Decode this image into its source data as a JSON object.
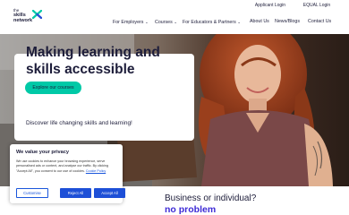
{
  "brand": {
    "line1": "the",
    "line2": "skills",
    "line3": "network",
    "accent": "#00c9a7",
    "accent_blue": "#2c4bd6"
  },
  "topbar": {
    "applicant_login": "Applicant Login",
    "equal_login": "EQUAL Login"
  },
  "nav": {
    "items": [
      {
        "label": "For Employers",
        "has_dropdown": true
      },
      {
        "label": "Courses",
        "has_dropdown": true
      },
      {
        "label": "For Educators & Partners",
        "has_dropdown": true
      },
      {
        "label": "About Us",
        "has_dropdown": false
      },
      {
        "label": "News/Blogs",
        "has_dropdown": false
      },
      {
        "label": "Contact Us",
        "has_dropdown": false
      }
    ],
    "chevron": "⌄"
  },
  "hero": {
    "title": "Making learning and skills accessible",
    "subtitle": "Discover life changing skills and learning!",
    "cta": "Explore our courses"
  },
  "section": {
    "heading": "Business or individual?",
    "highlight": "no problem",
    "highlight_color": "#3d2ad6"
  },
  "cookie": {
    "title": "We value your privacy",
    "text": "We use cookies to enhance your browsing experience, serve personalised ads or content, and analyse our traffic. By clicking \"Accept All\", you consent to our use of cookies.",
    "link": "Cookie Policy",
    "customize": "Customise",
    "reject": "Reject All",
    "accept": "Accept All",
    "button_color": "#1d4fd7"
  }
}
